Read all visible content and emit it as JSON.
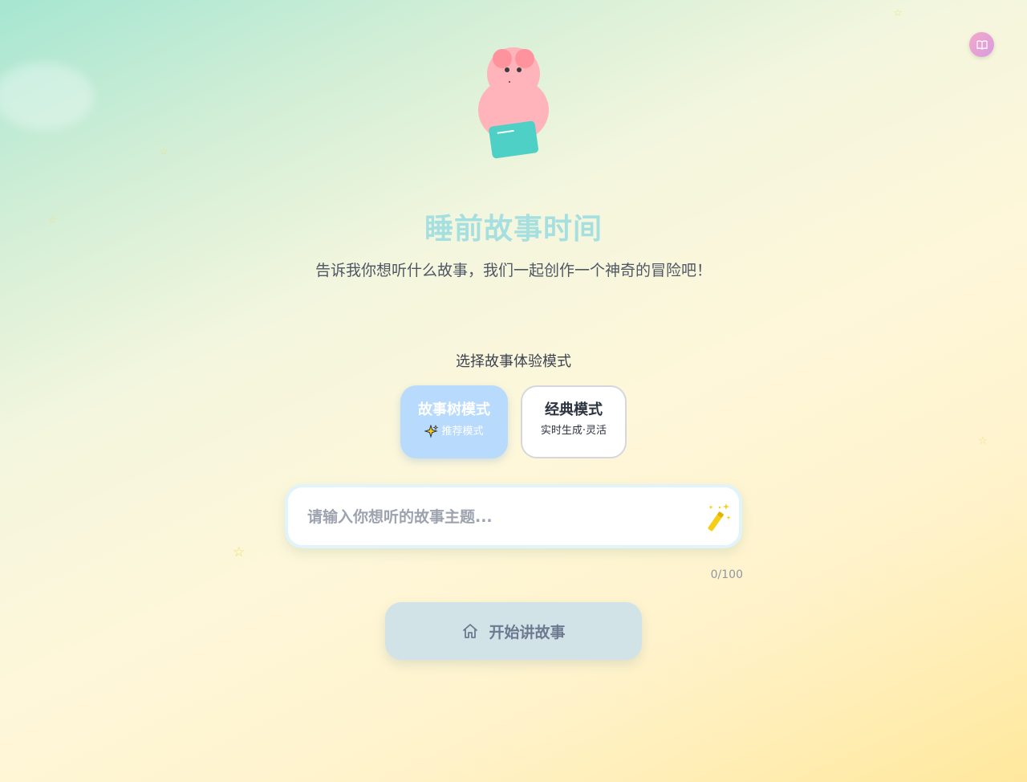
{
  "header": {
    "book_icon": "book-icon"
  },
  "hero": {
    "mascot": "pig-mascot-holding-book",
    "title": "睡前故事时间",
    "subtitle": "告诉我你想听什么故事，我们一起创作一个神奇的冒险吧！"
  },
  "mode_select": {
    "label": "选择故事体验模式",
    "options": [
      {
        "title": "故事树模式",
        "subtitle": "推荐模式",
        "icon": "sparkle-icon",
        "selected": true
      },
      {
        "title": "经典模式",
        "subtitle": "实时生成·灵活",
        "selected": false
      }
    ]
  },
  "story_input": {
    "value": "",
    "placeholder": "请输入你想听的故事主题...",
    "icon": "magic-wand-icon",
    "counter": "0/100"
  },
  "start_button": {
    "label": "开始讲故事",
    "icon": "home-icon"
  },
  "colors": {
    "title": "#a6dfe0",
    "selected_mode": "#b8dafc",
    "start_button": "#d2e3e8",
    "accent_yellow": "#f5cf17",
    "mascot_pink": "#ffb3bb",
    "book_teal": "#4fd0c6"
  }
}
